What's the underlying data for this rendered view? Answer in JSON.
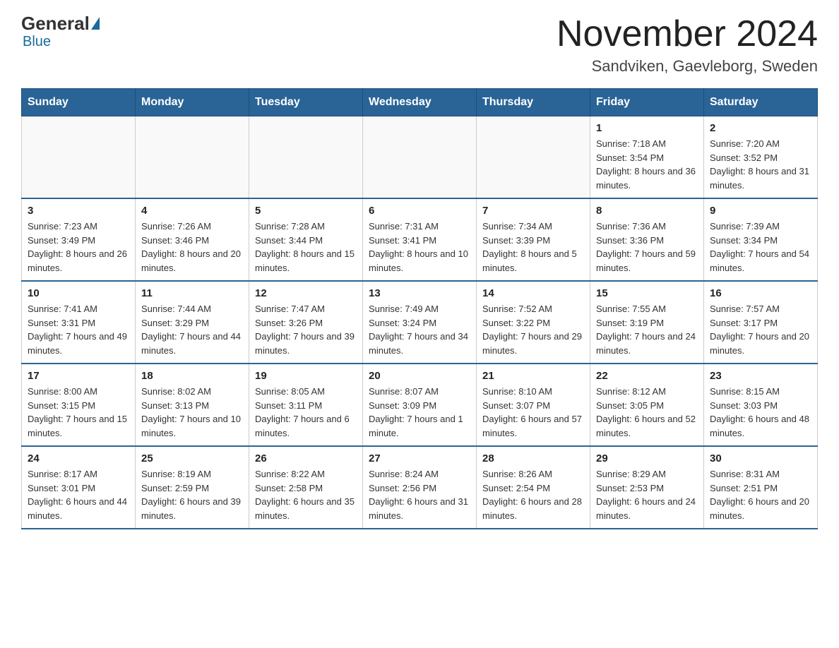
{
  "logo": {
    "general": "General",
    "blue": "Blue"
  },
  "header": {
    "month_year": "November 2024",
    "location": "Sandviken, Gaevleborg, Sweden"
  },
  "days_of_week": [
    "Sunday",
    "Monday",
    "Tuesday",
    "Wednesday",
    "Thursday",
    "Friday",
    "Saturday"
  ],
  "weeks": [
    [
      {
        "day": "",
        "info": ""
      },
      {
        "day": "",
        "info": ""
      },
      {
        "day": "",
        "info": ""
      },
      {
        "day": "",
        "info": ""
      },
      {
        "day": "",
        "info": ""
      },
      {
        "day": "1",
        "info": "Sunrise: 7:18 AM\nSunset: 3:54 PM\nDaylight: 8 hours and 36 minutes."
      },
      {
        "day": "2",
        "info": "Sunrise: 7:20 AM\nSunset: 3:52 PM\nDaylight: 8 hours and 31 minutes."
      }
    ],
    [
      {
        "day": "3",
        "info": "Sunrise: 7:23 AM\nSunset: 3:49 PM\nDaylight: 8 hours and 26 minutes."
      },
      {
        "day": "4",
        "info": "Sunrise: 7:26 AM\nSunset: 3:46 PM\nDaylight: 8 hours and 20 minutes."
      },
      {
        "day": "5",
        "info": "Sunrise: 7:28 AM\nSunset: 3:44 PM\nDaylight: 8 hours and 15 minutes."
      },
      {
        "day": "6",
        "info": "Sunrise: 7:31 AM\nSunset: 3:41 PM\nDaylight: 8 hours and 10 minutes."
      },
      {
        "day": "7",
        "info": "Sunrise: 7:34 AM\nSunset: 3:39 PM\nDaylight: 8 hours and 5 minutes."
      },
      {
        "day": "8",
        "info": "Sunrise: 7:36 AM\nSunset: 3:36 PM\nDaylight: 7 hours and 59 minutes."
      },
      {
        "day": "9",
        "info": "Sunrise: 7:39 AM\nSunset: 3:34 PM\nDaylight: 7 hours and 54 minutes."
      }
    ],
    [
      {
        "day": "10",
        "info": "Sunrise: 7:41 AM\nSunset: 3:31 PM\nDaylight: 7 hours and 49 minutes."
      },
      {
        "day": "11",
        "info": "Sunrise: 7:44 AM\nSunset: 3:29 PM\nDaylight: 7 hours and 44 minutes."
      },
      {
        "day": "12",
        "info": "Sunrise: 7:47 AM\nSunset: 3:26 PM\nDaylight: 7 hours and 39 minutes."
      },
      {
        "day": "13",
        "info": "Sunrise: 7:49 AM\nSunset: 3:24 PM\nDaylight: 7 hours and 34 minutes."
      },
      {
        "day": "14",
        "info": "Sunrise: 7:52 AM\nSunset: 3:22 PM\nDaylight: 7 hours and 29 minutes."
      },
      {
        "day": "15",
        "info": "Sunrise: 7:55 AM\nSunset: 3:19 PM\nDaylight: 7 hours and 24 minutes."
      },
      {
        "day": "16",
        "info": "Sunrise: 7:57 AM\nSunset: 3:17 PM\nDaylight: 7 hours and 20 minutes."
      }
    ],
    [
      {
        "day": "17",
        "info": "Sunrise: 8:00 AM\nSunset: 3:15 PM\nDaylight: 7 hours and 15 minutes."
      },
      {
        "day": "18",
        "info": "Sunrise: 8:02 AM\nSunset: 3:13 PM\nDaylight: 7 hours and 10 minutes."
      },
      {
        "day": "19",
        "info": "Sunrise: 8:05 AM\nSunset: 3:11 PM\nDaylight: 7 hours and 6 minutes."
      },
      {
        "day": "20",
        "info": "Sunrise: 8:07 AM\nSunset: 3:09 PM\nDaylight: 7 hours and 1 minute."
      },
      {
        "day": "21",
        "info": "Sunrise: 8:10 AM\nSunset: 3:07 PM\nDaylight: 6 hours and 57 minutes."
      },
      {
        "day": "22",
        "info": "Sunrise: 8:12 AM\nSunset: 3:05 PM\nDaylight: 6 hours and 52 minutes."
      },
      {
        "day": "23",
        "info": "Sunrise: 8:15 AM\nSunset: 3:03 PM\nDaylight: 6 hours and 48 minutes."
      }
    ],
    [
      {
        "day": "24",
        "info": "Sunrise: 8:17 AM\nSunset: 3:01 PM\nDaylight: 6 hours and 44 minutes."
      },
      {
        "day": "25",
        "info": "Sunrise: 8:19 AM\nSunset: 2:59 PM\nDaylight: 6 hours and 39 minutes."
      },
      {
        "day": "26",
        "info": "Sunrise: 8:22 AM\nSunset: 2:58 PM\nDaylight: 6 hours and 35 minutes."
      },
      {
        "day": "27",
        "info": "Sunrise: 8:24 AM\nSunset: 2:56 PM\nDaylight: 6 hours and 31 minutes."
      },
      {
        "day": "28",
        "info": "Sunrise: 8:26 AM\nSunset: 2:54 PM\nDaylight: 6 hours and 28 minutes."
      },
      {
        "day": "29",
        "info": "Sunrise: 8:29 AM\nSunset: 2:53 PM\nDaylight: 6 hours and 24 minutes."
      },
      {
        "day": "30",
        "info": "Sunrise: 8:31 AM\nSunset: 2:51 PM\nDaylight: 6 hours and 20 minutes."
      }
    ]
  ]
}
